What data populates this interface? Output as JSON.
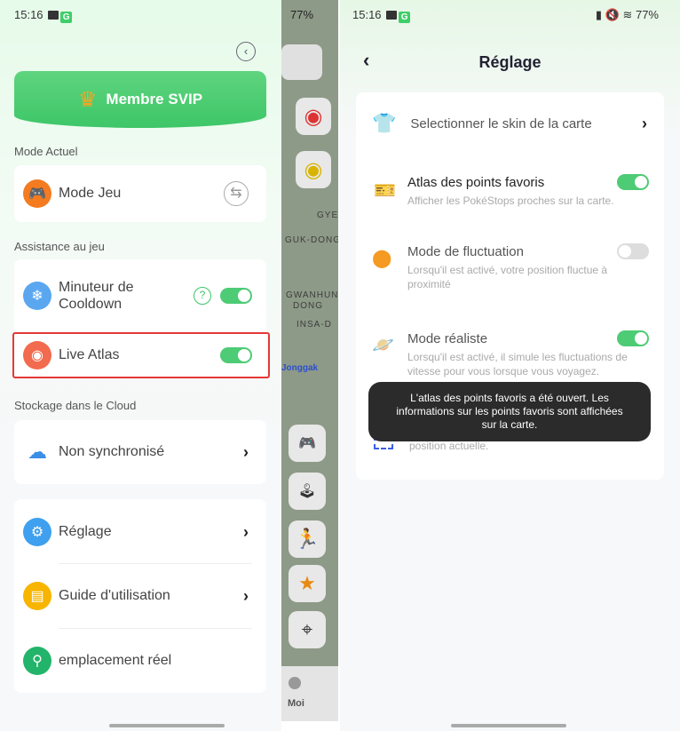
{
  "status": {
    "time": "15:16",
    "battery": "77%"
  },
  "left": {
    "svip_label": "Membre SVIP",
    "mode_section": "Mode Actuel",
    "mode_label": "Mode Jeu",
    "assist_section": "Assistance au jeu",
    "cooldown_label": "Minuteur de Cooldown",
    "cooldown_on": true,
    "help_glyph": "?",
    "live_atlas_label": "Live Atlas",
    "live_atlas_on": true,
    "cloud_section": "Stockage dans le Cloud",
    "cloud_label": "Non synchronisé",
    "menu": [
      {
        "label": "Réglage",
        "icon": "gear-icon"
      },
      {
        "label": "Guide d'utilisation",
        "icon": "book-icon"
      },
      {
        "label": "emplacement réel",
        "icon": "location-pin-icon"
      }
    ],
    "highlight_color": "#e53935"
  },
  "map": {
    "labels": [
      "GYE-",
      "GUK-DONG",
      "GWANHUN",
      "DONG",
      "INSA-D",
      "Jonggak"
    ],
    "tab_label": "Moi"
  },
  "right": {
    "title": "Réglage",
    "skin_label": "Selectionner le skin de la carte",
    "settings": [
      {
        "title": "Atlas des points favoris",
        "desc": "Afficher les PokéStops proches sur la carte.",
        "on": true
      },
      {
        "title": "Mode de fluctuation",
        "desc": "Lorsqu'il est activé, votre position fluctue à proximité",
        "on": false
      },
      {
        "title": "Mode réaliste",
        "desc": "Lorsqu'il est activé, il simule les fluctuations de vitesse pour vous lorsque vous voyagez.",
        "on": true
      },
      {
        "title": "",
        "desc": "Lorsque cette option est activée, la vue suit votre position actuelle."
      }
    ],
    "toast": "L'atlas des points favoris a été ouvert. Les informations sur les points favoris sont affichées sur la carte."
  },
  "colors": {
    "accent": "#4ecb75"
  }
}
